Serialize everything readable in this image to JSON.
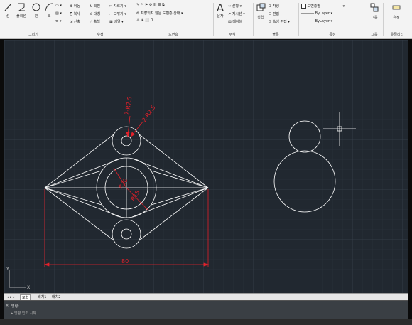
{
  "ribbon": {
    "draw": {
      "title": "그리기",
      "buttons": [
        "선",
        "폴리선",
        "원",
        "호"
      ]
    },
    "modify": {
      "title": "수정",
      "rows": [
        [
          "이동",
          "회전",
          "자르기"
        ],
        [
          "복사",
          "대칭",
          "모깎기"
        ],
        [
          "신축",
          "축척",
          "배열"
        ]
      ]
    },
    "layers": {
      "title": "도면층",
      "rows": [
        "저장되지 않은 도면층 상태",
        "0"
      ]
    },
    "annotation": {
      "title": "주석",
      "big": "문자",
      "rows": [
        "선형",
        "지시선",
        "테이블"
      ]
    },
    "block": {
      "title": "블록",
      "big": "삽입",
      "rows": [
        "작성",
        "편집",
        "속성 편집"
      ]
    },
    "properties": {
      "title": "특성",
      "rows": [
        "도면층별",
        "ByLayer",
        "ByLayer"
      ]
    },
    "groups": {
      "title": "그룹",
      "big": "그룹"
    },
    "utilities": {
      "title": "유틸리티",
      "big": "측정"
    }
  },
  "drawing": {
    "dims": {
      "top_r": "2-R7.5",
      "top_r2": "2-R2.5",
      "mid_r1": "R20",
      "mid_r2": "R15",
      "width": "80"
    }
  },
  "tabs": [
    "모형",
    "배치1",
    "배치2"
  ],
  "command": {
    "line1": "명령:",
    "prompt": "명령 입력 시작"
  },
  "colors": {
    "canvas": "#212830",
    "dimension": "#e3202a",
    "geometry": "#ffffff"
  }
}
